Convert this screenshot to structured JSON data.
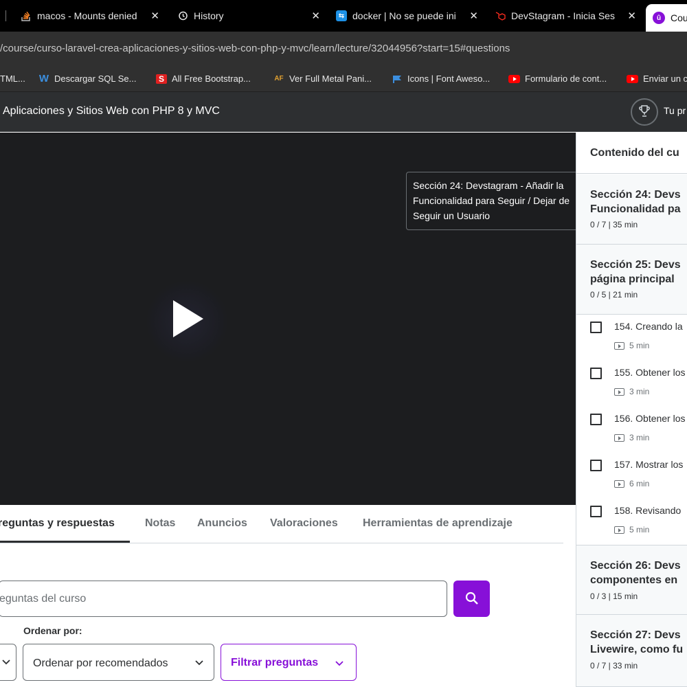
{
  "browser": {
    "tabs": [
      {
        "title": "macos - Mounts denied",
        "icon": "stackoverflow-icon",
        "color": "#f48024"
      },
      {
        "title": "History",
        "icon": "history-icon"
      },
      {
        "title": "docker | No se puede ini",
        "icon": "docker-icon",
        "color": "#1d91e6"
      },
      {
        "title": "DevStagram - Inicia Ses",
        "icon": "laravel-icon",
        "color": "#ff2d20"
      },
      {
        "title": "Cou",
        "icon": "udemy-icon",
        "color": "#8710d8"
      }
    ],
    "close_glyph": "✕",
    "url": "/course/curso-laravel-crea-aplicaciones-y-sitios-web-con-php-y-mvc/learn/lecture/32044956?start=15#questions",
    "bookmarks": [
      {
        "label": "TML...",
        "icon": ""
      },
      {
        "label": "Descargar SQL Se...",
        "icon": "W",
        "color": "#3b8ede"
      },
      {
        "label": "All Free Bootstrap...",
        "icon": "S",
        "color": "#e02020"
      },
      {
        "label": "Ver Full Metal Pani...",
        "icon": "AF",
        "color": "#e0a030"
      },
      {
        "label": "Icons | Font Aweso...",
        "icon": "flag-icon",
        "color": "#3b8ede"
      },
      {
        "label": "Formulario de cont...",
        "icon": "youtube-icon",
        "color": "#ff0000"
      },
      {
        "label": "Enviar un c",
        "icon": "youtube-icon",
        "color": "#ff0000"
      }
    ]
  },
  "course": {
    "title": "Aplicaciones y Sitios Web con PHP 8 y MVC",
    "progress_label": "Tu pr"
  },
  "video": {
    "tooltip": "Sección 24: Devstagram - Añadir la Funcionalidad para Seguir / Dejar de Seguir un Usuario"
  },
  "tabs": [
    {
      "label": "reguntas y respuestas",
      "active": true
    },
    {
      "label": "Notas"
    },
    {
      "label": "Anuncios"
    },
    {
      "label": "Valoraciones"
    },
    {
      "label": "Herramientas de aprendizaje"
    }
  ],
  "search": {
    "placeholder": "eguntas del curso"
  },
  "sort": {
    "label": "Ordenar por:",
    "value": "Ordenar por recomendados",
    "filter_label": "Filtrar preguntas"
  },
  "sidebar": {
    "header": "Contenido del cu",
    "sections": [
      {
        "line1": "Sección 24: Devs",
        "line2": "Funcionalidad pa",
        "meta": "0 / 7 | 35 min"
      },
      {
        "line1": "Sección 25: Devs",
        "line2": "página principal",
        "meta": "0 / 5 | 21 min"
      },
      {
        "line1": "Sección 26: Devs",
        "line2": "componentes en",
        "meta": "0 / 3 | 15 min"
      },
      {
        "line1": "Sección 27: Devs",
        "line2": "Livewire, como fu",
        "meta": "0 / 7 | 33 min"
      }
    ],
    "lectures": [
      {
        "title": "154. Creando la",
        "duration": "5 min"
      },
      {
        "title": "155. Obtener los",
        "duration": "3 min"
      },
      {
        "title": "156. Obtener los",
        "duration": "3 min"
      },
      {
        "title": "157. Mostrar los",
        "duration": "6 min"
      },
      {
        "title": "158. Revisando",
        "duration": "5 min"
      }
    ]
  },
  "colors": {
    "brand": "#8710d8",
    "dark": "#2d2f31",
    "video_bg": "#1c1d1f"
  }
}
